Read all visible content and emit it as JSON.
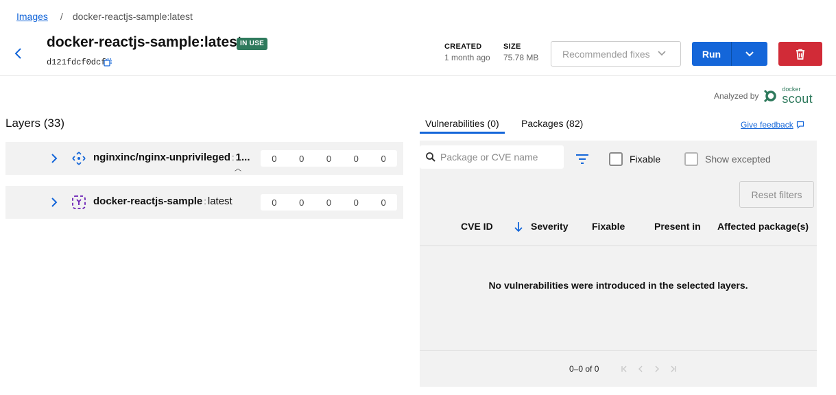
{
  "breadcrumb": {
    "root": "Images",
    "separator": "/",
    "current": "docker-reactjs-sample:latest"
  },
  "header": {
    "title": "docker-reactjs-sample:latest",
    "badge": "IN USE",
    "digest": "d121fdcf0dcf",
    "created_label": "CREATED",
    "created_value": "1 month ago",
    "size_label": "SIZE",
    "size_value": "75.78 MB"
  },
  "actions": {
    "recommended_fixes": "Recommended fixes",
    "run": "Run"
  },
  "analyzed": {
    "label": "Analyzed by",
    "brand_top": "docker",
    "brand": "scout"
  },
  "layers": {
    "title": "Layers (33)",
    "items": [
      {
        "name": "nginxinc/nginx-unprivileged",
        "tag": "1...",
        "counts": [
          "0",
          "0",
          "0",
          "0",
          "0"
        ],
        "icon": "base-image-icon"
      },
      {
        "name": "docker-reactjs-sample",
        "tag": "latest",
        "counts": [
          "0",
          "0",
          "0",
          "0",
          "0"
        ],
        "icon": "image-icon"
      }
    ]
  },
  "tabs": {
    "vulnerabilities": "Vulnerabilities (0)",
    "packages": "Packages (82)",
    "feedback": "Give feedback"
  },
  "filters": {
    "search_placeholder": "Package or CVE name",
    "fixable": "Fixable",
    "show_excepted": "Show excepted",
    "reset": "Reset filters"
  },
  "table": {
    "columns": [
      "CVE ID",
      "Severity",
      "Fixable",
      "Present in",
      "Affected package(s)"
    ],
    "empty": "No vulnerabilities were introduced in the selected layers.",
    "pagination": "0–0 of 0"
  },
  "colors": {
    "accent": "#1466d9",
    "danger": "#d12b37",
    "badge": "#2f7a5d"
  }
}
